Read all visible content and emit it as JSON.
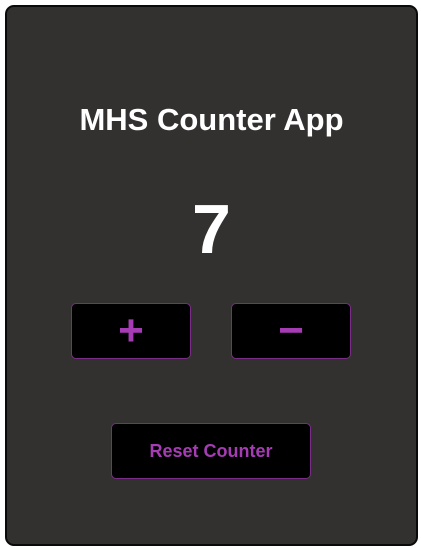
{
  "app": {
    "title": "MHS Counter App",
    "count": "7"
  },
  "buttons": {
    "increment_label": "+",
    "decrement_label": "−",
    "reset_label": "Reset Counter"
  },
  "colors": {
    "card_background": "#333130",
    "button_background": "#000000",
    "button_accent": "#a63cb4",
    "text": "#ffffff"
  }
}
